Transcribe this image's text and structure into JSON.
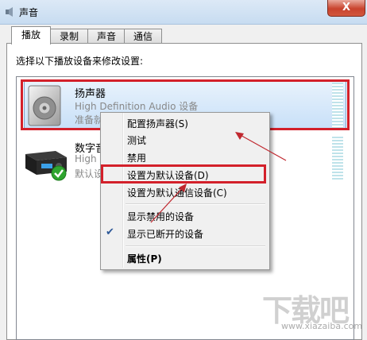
{
  "window": {
    "title": "声音",
    "close_label": "X"
  },
  "tabs": [
    "播放",
    "录制",
    "声音",
    "通信"
  ],
  "instruction": "选择以下播放设备来修改设置:",
  "devices": [
    {
      "name": "扬声器",
      "line1": "High Definition Audio 设备",
      "line2": "准备就绪",
      "selected": true
    },
    {
      "name": "数字音频",
      "line1": "High",
      "line2": "默认设备",
      "selected": false
    }
  ],
  "context_menu": {
    "items": [
      "配置扬声器(S)",
      "测试",
      "禁用",
      "设置为默认设备(D)",
      "设置为默认通信设备(C)",
      "显示禁用的设备",
      "显示已断开的设备",
      "属性(P)"
    ],
    "checked_item": "显示已断开的设备",
    "highlighted_item": "设置为默认设备(D)"
  },
  "watermark": {
    "logo": "下载吧",
    "url": "www.xiazaiba.com"
  },
  "colors": {
    "highlight_red": "#d3202a",
    "selection_blue": "#c8e0f8"
  }
}
